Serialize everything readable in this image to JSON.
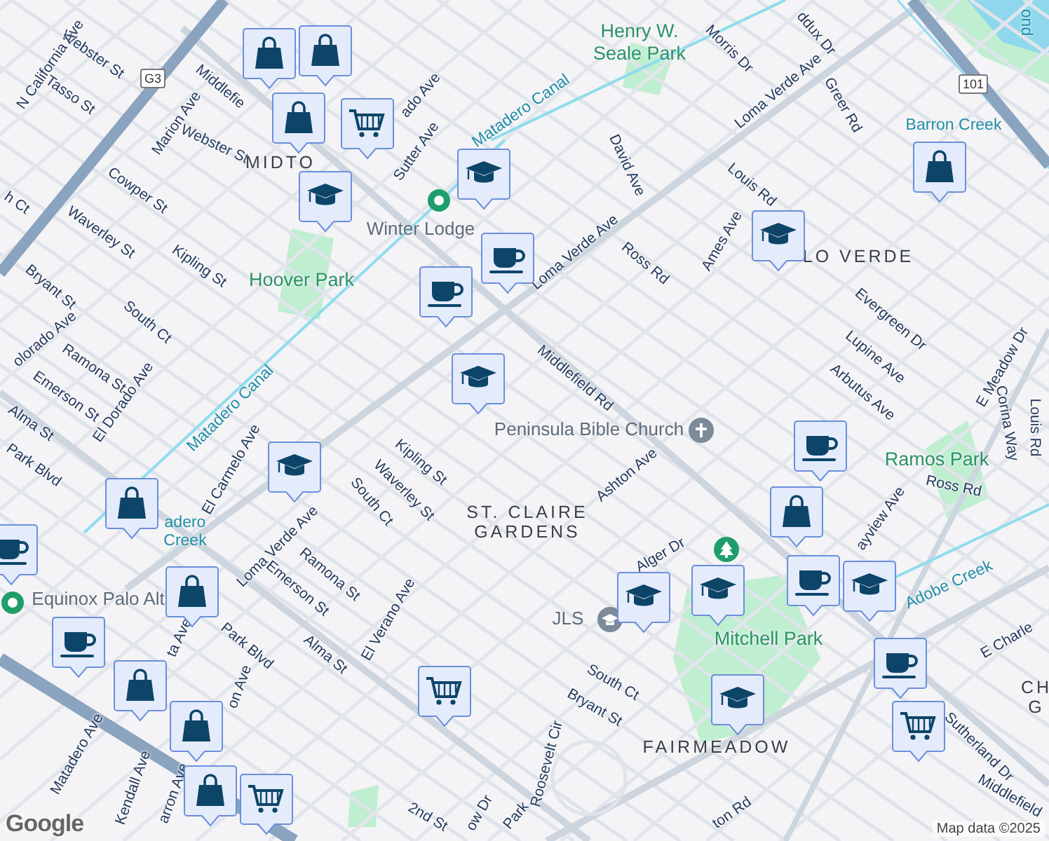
{
  "map": {
    "labels": [
      {
        "text": "ddux Dr",
        "kind": "street"
      },
      {
        "text": "ond",
        "kind": "water"
      },
      {
        "text": "Henry W.\nSeale Park",
        "kind": "park"
      },
      {
        "text": "Morris Dr",
        "kind": "street"
      },
      {
        "text": "Webster St",
        "kind": "street"
      },
      {
        "text": "N California Ave",
        "kind": "street"
      },
      {
        "text": "G3",
        "kind": "shield"
      },
      {
        "text": "101",
        "kind": "shield"
      },
      {
        "text": "Middlefie",
        "kind": "street"
      },
      {
        "text": "Tasso St",
        "kind": "street"
      },
      {
        "text": "Loma Verde Ave",
        "kind": "street"
      },
      {
        "text": "ado Ave",
        "kind": "street"
      },
      {
        "text": "Greer Rd",
        "kind": "street"
      },
      {
        "text": "Matadero Canal",
        "kind": "water"
      },
      {
        "text": "Marion Ave",
        "kind": "street"
      },
      {
        "text": "Barron Creek",
        "kind": "water"
      },
      {
        "text": "Webster St",
        "kind": "street"
      },
      {
        "text": "Sutter Ave",
        "kind": "street"
      },
      {
        "text": "MIDTO",
        "kind": "neighborhood"
      },
      {
        "text": "David Ave",
        "kind": "street"
      },
      {
        "text": "Louis Rd",
        "kind": "street"
      },
      {
        "text": "Cowper St",
        "kind": "street"
      },
      {
        "text": "h Ct",
        "kind": "street"
      },
      {
        "text": "Winter Lodge",
        "kind": "place"
      },
      {
        "text": "Waverley St",
        "kind": "street"
      },
      {
        "text": "Ames Ave",
        "kind": "street"
      },
      {
        "text": "Loma Verde Ave",
        "kind": "street"
      },
      {
        "text": "LO VERDE",
        "kind": "neighborhood"
      },
      {
        "text": "Ross Rd",
        "kind": "street"
      },
      {
        "text": "Kipling St",
        "kind": "street"
      },
      {
        "text": "Hoover Park",
        "kind": "park"
      },
      {
        "text": "Bryant St",
        "kind": "street"
      },
      {
        "text": "Evergreen Dr",
        "kind": "street"
      },
      {
        "text": "South Ct",
        "kind": "street"
      },
      {
        "text": "olorado Ave",
        "kind": "street"
      },
      {
        "text": "Lupine Ave",
        "kind": "street"
      },
      {
        "text": "E Meadow Dr",
        "kind": "street"
      },
      {
        "text": "Ramona St",
        "kind": "street"
      },
      {
        "text": "Middlefield Rd",
        "kind": "street"
      },
      {
        "text": "Arbutus Ave",
        "kind": "street"
      },
      {
        "text": "Emerson St",
        "kind": "street"
      },
      {
        "text": "El Dorado Ave",
        "kind": "street"
      },
      {
        "text": "Matadero Canal",
        "kind": "water"
      },
      {
        "text": "Alma St",
        "kind": "street"
      },
      {
        "text": "Corina Way",
        "kind": "street"
      },
      {
        "text": "Louis Rd",
        "kind": "street"
      },
      {
        "text": "Peninsula Bible Church",
        "kind": "place"
      },
      {
        "text": "Ramos Park",
        "kind": "park"
      },
      {
        "text": "Kipling St",
        "kind": "street"
      },
      {
        "text": "Park Blvd",
        "kind": "street"
      },
      {
        "text": "El Carmelo Ave",
        "kind": "street"
      },
      {
        "text": "Ashton Ave",
        "kind": "street"
      },
      {
        "text": "Ross Rd",
        "kind": "street"
      },
      {
        "text": "Waverley St",
        "kind": "street"
      },
      {
        "text": "South Ct",
        "kind": "street"
      },
      {
        "text": "ayview Ave",
        "kind": "street"
      },
      {
        "text": "adero\nCreek",
        "kind": "water"
      },
      {
        "text": "ST. CLAIRE\nGARDENS",
        "kind": "neighborhood"
      },
      {
        "text": "Loma Verde Ave",
        "kind": "street"
      },
      {
        "text": "Alger Dr",
        "kind": "street"
      },
      {
        "text": "Ramona St",
        "kind": "street"
      },
      {
        "text": "Adobe Creek",
        "kind": "water"
      },
      {
        "text": "Emerson St",
        "kind": "street"
      },
      {
        "text": "Equinox Palo Alt",
        "kind": "place"
      },
      {
        "text": "JLS",
        "kind": "place"
      },
      {
        "text": "El Verano Ave",
        "kind": "street"
      },
      {
        "text": "ta Ave",
        "kind": "street"
      },
      {
        "text": "Mitchell Park",
        "kind": "park"
      },
      {
        "text": "E Charle",
        "kind": "street"
      },
      {
        "text": "Park Blvd",
        "kind": "street"
      },
      {
        "text": "Alma St",
        "kind": "street"
      },
      {
        "text": "South Ct",
        "kind": "street"
      },
      {
        "text": "on Ave",
        "kind": "street"
      },
      {
        "text": "CH\nG",
        "kind": "neighborhood"
      },
      {
        "text": "Bryant St",
        "kind": "street"
      },
      {
        "text": "FAIRMEADOW",
        "kind": "neighborhood"
      },
      {
        "text": "Sutherland Dr",
        "kind": "street"
      },
      {
        "text": "Roosevelt Cir",
        "kind": "street"
      },
      {
        "text": "Matadero Ave",
        "kind": "street"
      },
      {
        "text": "Middlefield",
        "kind": "street"
      },
      {
        "text": "Kendall Ave",
        "kind": "street"
      },
      {
        "text": "arron Ave",
        "kind": "street"
      },
      {
        "text": "2nd St",
        "kind": "street"
      },
      {
        "text": "ton Rd",
        "kind": "street"
      },
      {
        "text": "ow Dr",
        "kind": "street"
      },
      {
        "text": "Park",
        "kind": "street"
      }
    ],
    "poi_icons": [
      {
        "kind": "dot"
      },
      {
        "kind": "church"
      },
      {
        "kind": "tree"
      },
      {
        "kind": "dot"
      },
      {
        "kind": "school"
      }
    ],
    "pins": [
      {
        "kind": "shop"
      },
      {
        "kind": "shop"
      },
      {
        "kind": "grocery"
      },
      {
        "kind": "school"
      },
      {
        "kind": "school"
      },
      {
        "kind": "cafe"
      },
      {
        "kind": "school"
      },
      {
        "kind": "school"
      },
      {
        "kind": "shop"
      },
      {
        "kind": "school"
      },
      {
        "kind": "shop"
      },
      {
        "kind": "cafe"
      },
      {
        "kind": "shop"
      },
      {
        "kind": "cafe"
      },
      {
        "kind": "shop"
      },
      {
        "kind": "shop"
      },
      {
        "kind": "shop"
      },
      {
        "kind": "grocery"
      },
      {
        "kind": "grocery"
      },
      {
        "kind": "school"
      },
      {
        "kind": "school"
      },
      {
        "kind": "shop"
      },
      {
        "kind": "cafe"
      },
      {
        "kind": "school"
      },
      {
        "kind": "school"
      },
      {
        "kind": "cafe"
      },
      {
        "kind": "grocery"
      },
      {
        "kind": "shop"
      },
      {
        "kind": "cafe"
      },
      {
        "kind": "cafe"
      }
    ]
  },
  "attribution": {
    "logo": "Google",
    "copyright": "Map data ©2025"
  }
}
